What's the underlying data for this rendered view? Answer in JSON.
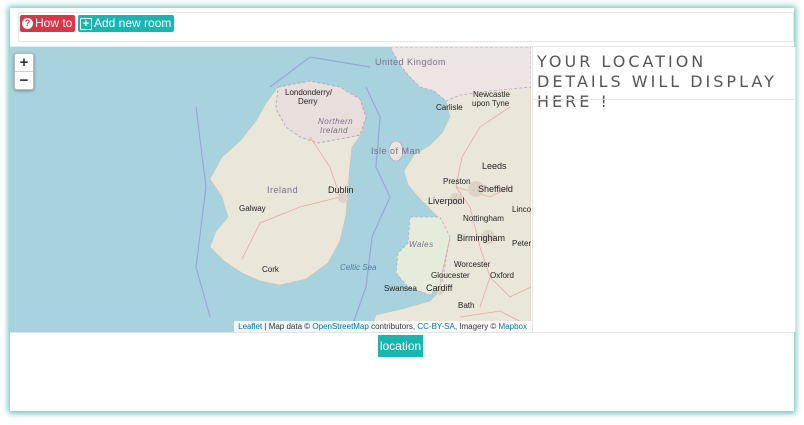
{
  "toolbar": {
    "howto_label": "How to",
    "howto_icon": "question-circle-icon",
    "add_room_label": "Add new room",
    "add_room_icon": "plus-square-icon",
    "howto_color": "#d9364a",
    "accent_color": "#19b5b0"
  },
  "map": {
    "zoom_in": "+",
    "zoom_out": "−",
    "labels": {
      "united_kingdom": "United Kingdom",
      "londonderry": "Londonderry/",
      "derry": "Derry",
      "northern": "Northern",
      "ireland_ni": "Ireland",
      "carlisle": "Carlisle",
      "newcastle": "Newcastle",
      "upon_tyne": "upon Tyne",
      "isle_of_man": "Isle of Man",
      "ireland": "Ireland",
      "dublin": "Dublin",
      "galway": "Galway",
      "leeds": "Leeds",
      "preston": "Preston",
      "sheffield": "Sheffield",
      "liverpool": "Liverpool",
      "nottingham": "Nottingham",
      "lincoln": "Linco",
      "wales": "Wales",
      "birmingham": "Birmingham",
      "peterborough": "Peterl",
      "cork": "Cork",
      "celtic_sea": "Celtic Sea",
      "worcester": "Worcester",
      "gloucester": "Gloucester",
      "oxford": "Oxford",
      "swansea": "Swansea",
      "cardiff": "Cardiff",
      "bath": "Bath"
    },
    "attribution": {
      "leaflet": "Leaflet",
      "sep1": " | Map data © ",
      "osm": "OpenStreetMap",
      "contributors": " contributors, ",
      "license": "CC-BY-SA",
      "imagery": ", Imagery © ",
      "mapbox": "Mapbox"
    },
    "water_color": "#a9d2df",
    "land_color": "#eae6da"
  },
  "details": {
    "title": "Your location details will display here !"
  },
  "location_button": {
    "label": "location"
  }
}
